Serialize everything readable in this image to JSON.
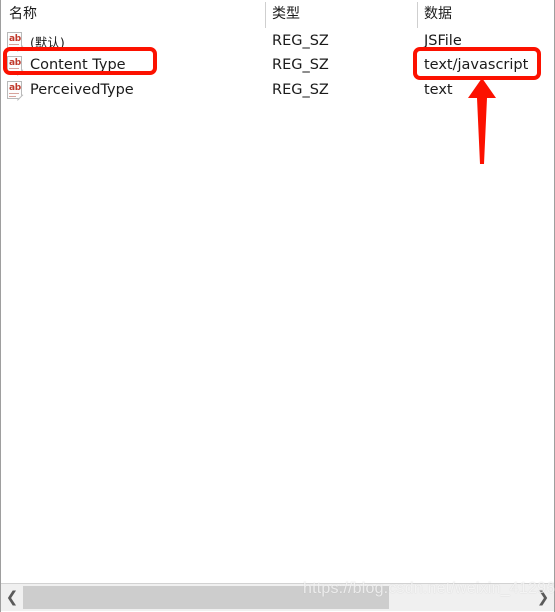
{
  "window": {
    "kind": "registry-editor-values-pane"
  },
  "columns": {
    "name_header": "名称",
    "type_header": "类型",
    "data_header": "数据"
  },
  "rows": [
    {
      "icon": "string-value-ab-icon",
      "name": "(默认)",
      "type": "REG_SZ",
      "data": "JSFile"
    },
    {
      "icon": "string-value-ab-icon",
      "name": "Content Type",
      "type": "REG_SZ",
      "data": "text/javascript"
    },
    {
      "icon": "string-value-ab-icon",
      "name": "PerceivedType",
      "type": "REG_SZ",
      "data": "text"
    }
  ],
  "icon_label": "ab",
  "annotations": {
    "color": "#fc1100",
    "highlight_name": "Content Type",
    "highlight_data": "text/javascript",
    "arrow_direction": "up"
  },
  "scrollbar": {
    "left_arrow": "❮",
    "right_arrow": "❯"
  },
  "watermark": {
    "text": "https://blog.csdn.net/weixin_41296877"
  }
}
